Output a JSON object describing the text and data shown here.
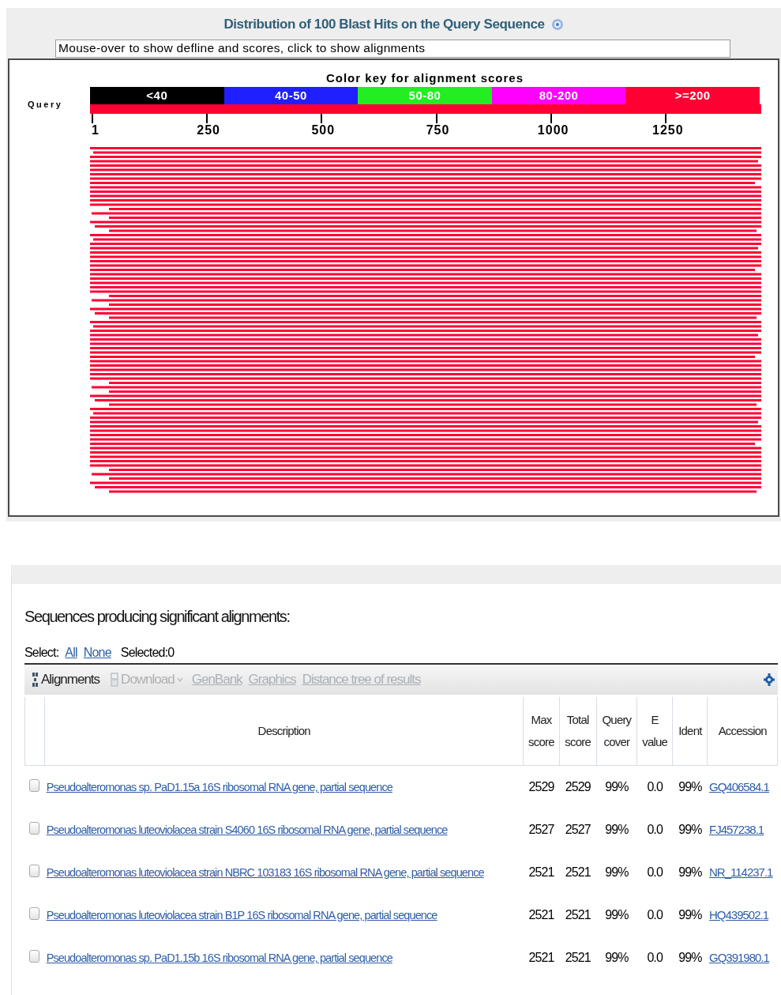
{
  "graphic": {
    "title": "Distribution of 100 Blast Hits on the Query Sequence",
    "info_line": "Mouse-over to show defline and scores, click to show alignments",
    "color_key": {
      "title": "Color key for alignment scores",
      "ranges": [
        {
          "label": "<40",
          "color": "#000000"
        },
        {
          "label": "40-50",
          "color": "#2020ff"
        },
        {
          "label": "50-80",
          "color": "#22ee22"
        },
        {
          "label": "80-200",
          "color": "#ff00ff"
        },
        {
          "label": ">=200",
          "color": "#ff0033"
        }
      ]
    },
    "query_label": "Query",
    "ticks": [
      "1",
      "250",
      "500",
      "750",
      "1000",
      "1250"
    ]
  },
  "results": {
    "title": "Sequences producing significant alignments:",
    "select": {
      "label": "Select:",
      "links": [
        "All",
        "None"
      ],
      "count": "Selected:0"
    },
    "toolbar": [
      {
        "kind": "sort",
        "label": "Alignments",
        "disabled": false
      },
      {
        "kind": "download",
        "label": "Download",
        "disabled": true
      },
      {
        "kind": "link",
        "label": "GenBank",
        "disabled": true
      },
      {
        "kind": "link",
        "label": "Graphics",
        "disabled": true
      },
      {
        "kind": "link",
        "label": "Distance tree of results",
        "disabled": true
      }
    ],
    "columns": [
      "Description",
      "Max score",
      "Total score",
      "Query cover",
      "E value",
      "Ident",
      "Accession"
    ],
    "rows": [
      {
        "checked": false,
        "description": "Pseudoalteromonas sp. PaD1.15a 16S ribosomal RNA gene, partial sequence",
        "max_score": "2529",
        "total_score": "2529",
        "query_cover": "99%",
        "e_value": "0.0",
        "ident": "99%",
        "accession": "GQ406584.1"
      },
      {
        "checked": false,
        "description": "Pseudoalteromonas luteoviolacea strain S4060 16S ribosomal RNA gene, partial sequence",
        "max_score": "2527",
        "total_score": "2527",
        "query_cover": "99%",
        "e_value": "0.0",
        "ident": "99%",
        "accession": "FJ457238.1"
      },
      {
        "checked": false,
        "description": "Pseudoalteromonas luteoviolacea strain NBRC 103183 16S ribosomal RNA gene, partial sequence",
        "max_score": "2521",
        "total_score": "2521",
        "query_cover": "99%",
        "e_value": "0.0",
        "ident": "99%",
        "accession": "NR_114237.1"
      },
      {
        "checked": false,
        "description": "Pseudoalteromonas luteoviolacea strain B1P 16S ribosomal RNA gene, partial sequence",
        "max_score": "2521",
        "total_score": "2521",
        "query_cover": "99%",
        "e_value": "0.0",
        "ident": "99%",
        "accession": "HQ439502.1"
      },
      {
        "checked": false,
        "description": "Pseudoalteromonas sp. PaD1.15b 16S ribosomal RNA gene, partial sequence",
        "max_score": "2521",
        "total_score": "2521",
        "query_cover": "99%",
        "e_value": "0.0",
        "ident": "99%",
        "accession": "GQ391980.1"
      }
    ]
  }
}
